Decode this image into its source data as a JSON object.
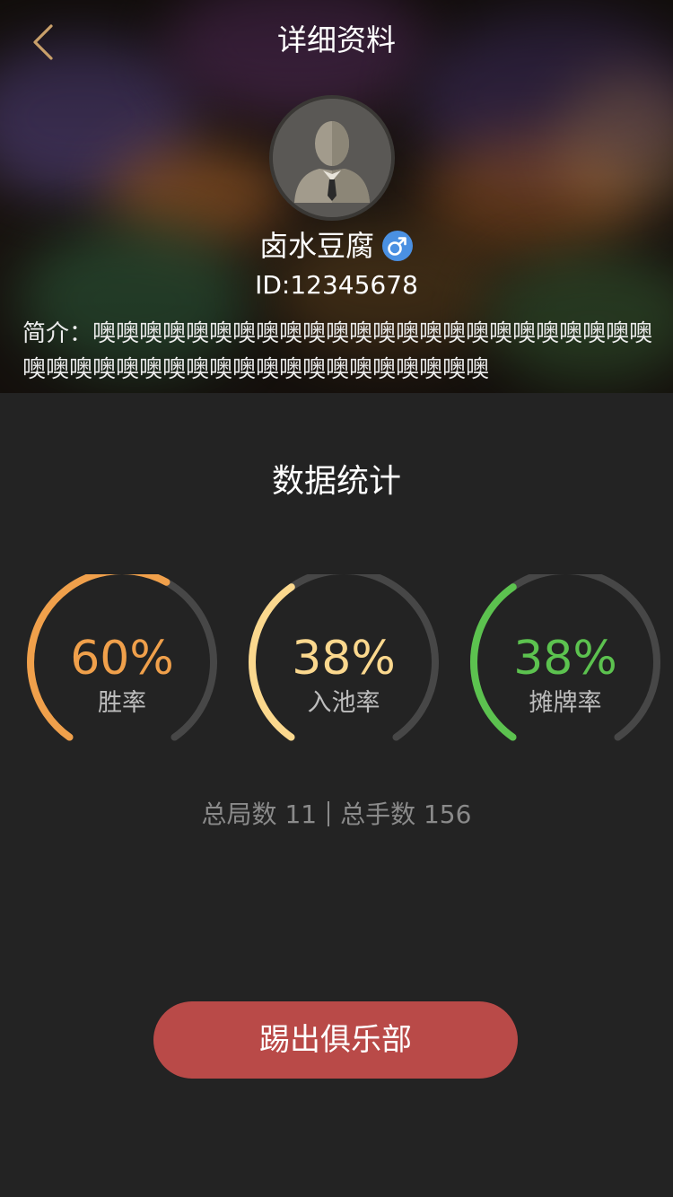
{
  "header": {
    "title": "详细资料"
  },
  "profile": {
    "name": "卤水豆腐",
    "gender_icon": "male-icon",
    "id_text": "ID:12345678",
    "bio_label": "简介：",
    "bio_text": "噢噢噢噢噢噢噢噢噢噢噢噢噢噢噢噢噢噢噢噢噢噢噢噢噢噢噢噢噢噢噢噢噢噢噢噢噢噢噢噢噢噢噢噢"
  },
  "stats": {
    "title": "数据统计",
    "gauges": [
      {
        "value": "60%",
        "label": "胜率",
        "fraction": 0.6,
        "color": "#f0a04b"
      },
      {
        "value": "38%",
        "label": "入池率",
        "fraction": 0.38,
        "color": "#fbd88e"
      },
      {
        "value": "38%",
        "label": "摊牌率",
        "fraction": 0.38,
        "color": "#5cc24f"
      }
    ],
    "track_color": "#474747",
    "summary_left": "总局数 11",
    "summary_right": "总手数 156"
  },
  "actions": {
    "kick_label": "踢出俱乐部",
    "kick_color": "#b94a48"
  },
  "colors": {
    "accent_gold": "#c9a06a",
    "gender_blue": "#4a90e2"
  }
}
